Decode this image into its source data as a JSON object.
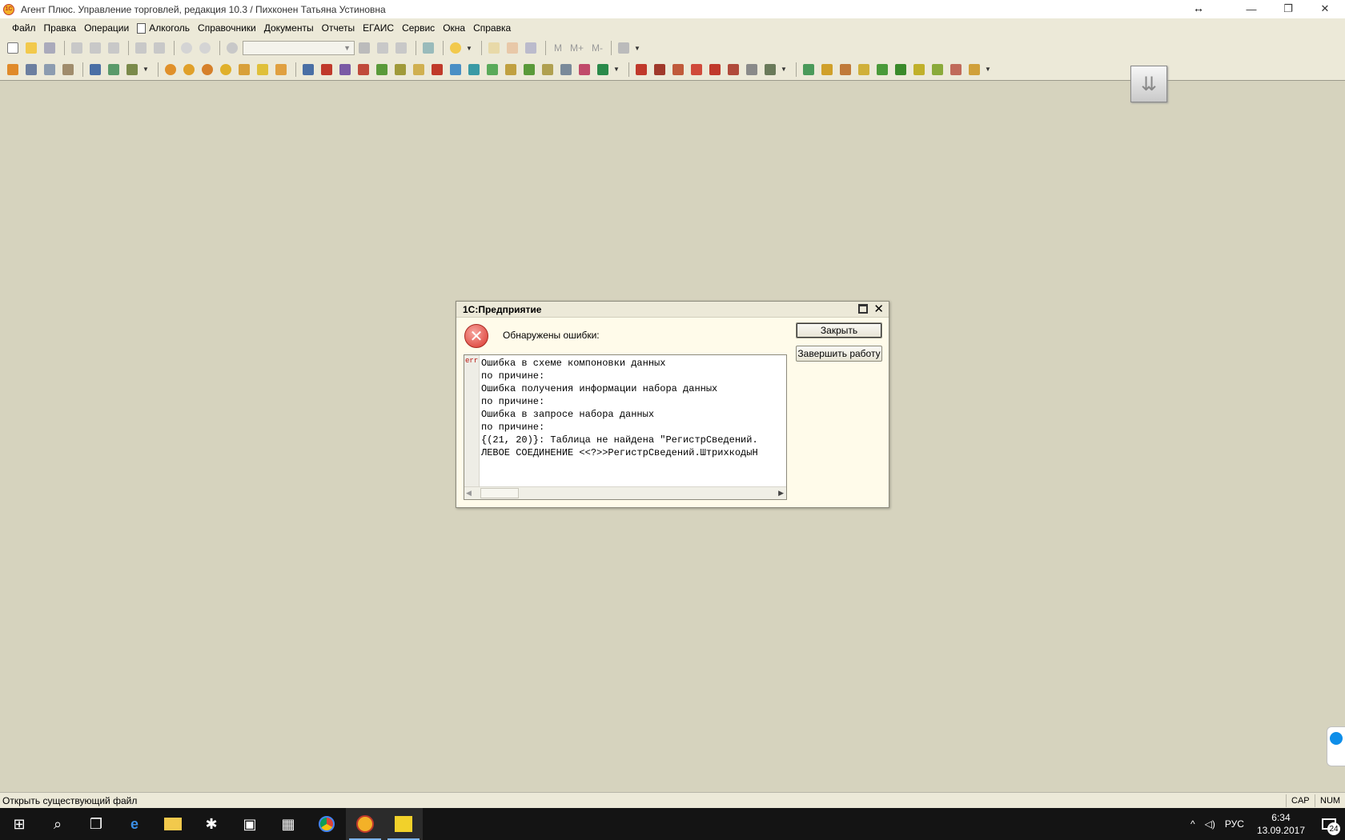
{
  "window": {
    "title": "Агент Плюс. Управление торговлей, редакция 10.3 / Пихконен Татьяна Устиновна",
    "logo_text": "1С",
    "resize_glyph": "↔",
    "minimize": "—",
    "restore": "❐",
    "close": "✕"
  },
  "menu": [
    {
      "label": "Файл",
      "name": "menu-file"
    },
    {
      "label": "Правка",
      "name": "menu-edit"
    },
    {
      "label": "Операции",
      "name": "menu-operations"
    },
    {
      "label": "Алкоголь",
      "name": "menu-alcohol"
    },
    {
      "label": "Справочники",
      "name": "menu-catalogs"
    },
    {
      "label": "Документы",
      "name": "menu-documents"
    },
    {
      "label": "Отчеты",
      "name": "menu-reports"
    },
    {
      "label": "ЕГАИС",
      "name": "menu-egais"
    },
    {
      "label": "Сервис",
      "name": "menu-service"
    },
    {
      "label": "Окна",
      "name": "menu-windows"
    },
    {
      "label": "Справка",
      "name": "menu-help"
    }
  ],
  "toolbar1": {
    "m_labels": [
      "M",
      "M+",
      "M-"
    ]
  },
  "colors": {
    "accent": "#f3b128",
    "error": "#d9342b",
    "background": "#d6d3be",
    "panel": "#ece9d8"
  },
  "dialog": {
    "title": "1С:Предприятие",
    "message": "Обнаружены ошибки:",
    "close_button": "Закрыть",
    "exit_button": "Завершить работу",
    "err_tag": "err",
    "error_lines": [
      "Ошибка в схеме компоновки данных",
      "по причине:",
      "Ошибка получения информации набора данных",
      "по причине:",
      "Ошибка в запросе набора данных",
      "по причине:",
      "{(21, 20)}: Таблица не найдена \"РегистрСведений.",
      "ЛЕВОЕ СОЕДИНЕНИЕ <<?>>РегистрСведений.ШтрихкодыН"
    ]
  },
  "status": {
    "text": "Открыть существующий файл",
    "cap": "CAP",
    "num": "NUM"
  },
  "taskbar": {
    "lang": "РУС",
    "time": "6:34",
    "date": "13.09.2017",
    "notifications": "24"
  }
}
